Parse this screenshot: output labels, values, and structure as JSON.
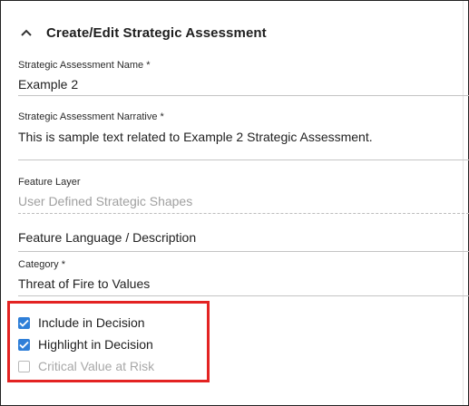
{
  "panel": {
    "title": "Create/Edit Strategic Assessment",
    "collapse_icon": "chevron-up-icon"
  },
  "fields": {
    "name": {
      "label": "Strategic Assessment Name *",
      "value": "Example 2"
    },
    "narrative": {
      "label": "Strategic Assessment Narrative *",
      "value": "This is sample text related to Example 2 Strategic Assessment."
    },
    "feature_layer": {
      "label": "Feature Layer",
      "value": "User Defined Strategic Shapes"
    },
    "feature_language": {
      "value": "Feature Language / Description"
    },
    "category": {
      "label": "Category *",
      "value": "Threat of Fire to Values"
    }
  },
  "checkboxes": [
    {
      "label": "Include in Decision",
      "checked": true,
      "disabled": false
    },
    {
      "label": "Highlight in Decision",
      "checked": true,
      "disabled": false
    },
    {
      "label": "Critical Value at Risk",
      "checked": false,
      "disabled": true
    }
  ],
  "colors": {
    "accent": "#2f7fd8",
    "highlight": "#e32322"
  }
}
